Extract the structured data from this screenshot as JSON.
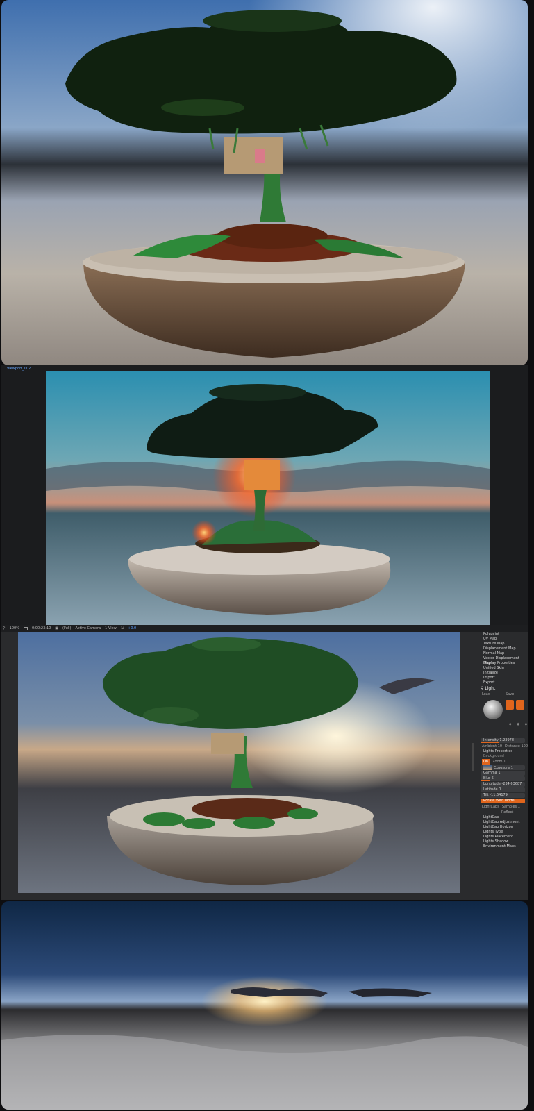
{
  "viewport_tab": {
    "label": "Viewport_002"
  },
  "toolbar": {
    "zoom": "100%",
    "timecode": "0:00:23:10",
    "display_mode": "(Full)",
    "camera": "Active Camera",
    "view_count": "1 View",
    "extra": "+0.0"
  },
  "side_menu": {
    "items_top": [
      "Polypaint",
      "UV Map",
      "Texture Map",
      "Displacement Map",
      "Normal Map",
      "Vector Displacement Map",
      "Display Properties",
      "Unified Skin",
      "Initialize",
      "Import",
      "Export"
    ],
    "light_section": "Light",
    "load_label": "Load",
    "save_label": "Save",
    "intensity": "Intensity 1.23978",
    "ambient": "Ambient 10",
    "distance": "Distance 100",
    "lights_properties": "Lights Properties",
    "background": "Background",
    "on": "On",
    "zoom": "Zoom 1",
    "exposure": "Exposure 1",
    "gamma": "Gamma 1",
    "blur": "Blur 6",
    "longitude": "Longitude -234.63687",
    "latitude": "Latitude 0",
    "tilt": "Tilt -11.64179",
    "rotate_with_model": "Rotate With Model",
    "lightcaps": "LightCaps",
    "samples": "Samples 1",
    "reflect": "Reflect",
    "items_bottom": [
      "LightCap",
      "LightCap Adjustment",
      "LightCap Horizon",
      "Lights Type",
      "Lights Placement",
      "Lights Shadow",
      "Environment Maps"
    ]
  },
  "colors": {
    "accent": "#e0651c",
    "tab_blue": "#5aa0ff"
  },
  "icons": [
    "light-bulb-icon",
    "camera-icon",
    "arrow-icon"
  ]
}
